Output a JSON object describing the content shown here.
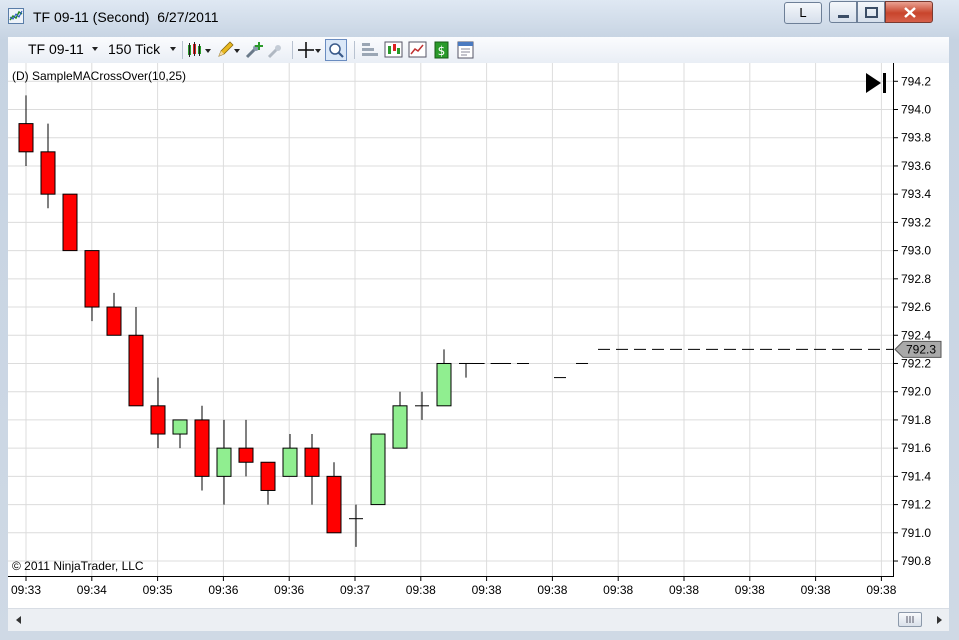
{
  "window": {
    "title": "TF 09-11 (Second)  6/27/2011",
    "l_button_label": "L",
    "colors": {
      "up_candle": "#90ee90",
      "down_candle": "#ff0000",
      "grid": "#dcdcdc",
      "price_marker": "#a9a9a9"
    }
  },
  "toolbar": {
    "instrument_label": "TF 09-11",
    "interval_label": "150 Tick",
    "icons": [
      "bar-type-icon",
      "pencil-draw-icon",
      "add-indicator-icon",
      "remove-indicator-icon",
      "crosshair-icon",
      "zoom-icon",
      "data-box-icon",
      "chart-style-icon",
      "strategy-icon",
      "dollar-performance-icon",
      "properties-icon"
    ]
  },
  "chart": {
    "indicator_label": "(D) SampleMACrossOver(10,25)",
    "copyright": "© 2011 NinjaTrader, LLC",
    "last_price_label": "792.3"
  },
  "chart_data": {
    "type": "candlestick",
    "y_range": [
      790.7,
      794.3
    ],
    "y_ticks": [
      "794.2",
      "794.0",
      "793.8",
      "793.6",
      "793.4",
      "793.2",
      "793.0",
      "792.8",
      "792.6",
      "792.4",
      "792.2",
      "792.0",
      "791.8",
      "791.6",
      "791.4",
      "791.2",
      "791.0",
      "790.8"
    ],
    "x_labels": [
      "09:33",
      "09:34",
      "09:35",
      "09:36",
      "09:36",
      "09:37",
      "09:38",
      "09:38",
      "09:38",
      "09:38",
      "09:38",
      "09:38",
      "09:38",
      "09:38"
    ],
    "grid": true,
    "candles": [
      {
        "o": 793.9,
        "h": 794.1,
        "l": 793.6,
        "c": 793.7
      },
      {
        "o": 793.7,
        "h": 793.9,
        "l": 793.3,
        "c": 793.4
      },
      {
        "o": 793.4,
        "h": 793.4,
        "l": 793.0,
        "c": 793.0
      },
      {
        "o": 793.0,
        "h": 793.0,
        "l": 792.5,
        "c": 792.6
      },
      {
        "o": 792.6,
        "h": 792.7,
        "l": 792.4,
        "c": 792.4
      },
      {
        "o": 792.4,
        "h": 792.6,
        "l": 791.9,
        "c": 791.9
      },
      {
        "o": 791.9,
        "h": 792.1,
        "l": 791.6,
        "c": 791.7
      },
      {
        "o": 791.7,
        "h": 791.8,
        "l": 791.6,
        "c": 791.8
      },
      {
        "o": 791.8,
        "h": 791.9,
        "l": 791.3,
        "c": 791.4
      },
      {
        "o": 791.4,
        "h": 791.8,
        "l": 791.2,
        "c": 791.6
      },
      {
        "o": 791.6,
        "h": 791.8,
        "l": 791.4,
        "c": 791.5
      },
      {
        "o": 791.5,
        "h": 791.5,
        "l": 791.2,
        "c": 791.3
      },
      {
        "o": 791.4,
        "h": 791.7,
        "l": 791.4,
        "c": 791.6
      },
      {
        "o": 791.6,
        "h": 791.7,
        "l": 791.2,
        "c": 791.4
      },
      {
        "o": 791.4,
        "h": 791.5,
        "l": 791.0,
        "c": 791.0
      },
      {
        "o": 791.1,
        "h": 791.2,
        "l": 790.9,
        "c": 791.1
      },
      {
        "o": 791.2,
        "h": 791.7,
        "l": 791.2,
        "c": 791.7
      },
      {
        "o": 791.6,
        "h": 792.0,
        "l": 791.6,
        "c": 791.9
      },
      {
        "o": 791.9,
        "h": 792.0,
        "l": 791.8,
        "c": 791.9
      },
      {
        "o": 791.9,
        "h": 792.3,
        "l": 791.9,
        "c": 792.2
      },
      {
        "o": 792.2,
        "h": 792.2,
        "l": 792.1,
        "c": 792.2
      }
    ],
    "flat_ticks": [
      {
        "price": 792.2,
        "start": 20.3,
        "end": 21.5
      },
      {
        "price": 792.2,
        "start": 21.5,
        "end": 23.0
      },
      {
        "price": 792.1,
        "start": 24.0,
        "end": 24.6
      },
      {
        "price": 792.2,
        "start": 25.0,
        "end": 25.8
      }
    ],
    "last_price": 792.3
  }
}
